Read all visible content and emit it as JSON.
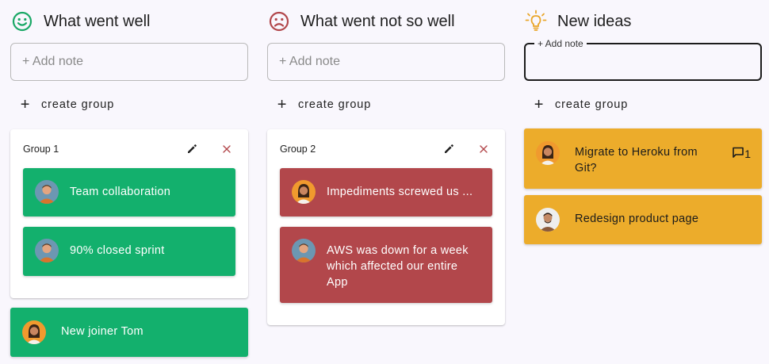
{
  "columns": [
    {
      "title": "What went well",
      "icon": "smile-icon",
      "input_placeholder": "+ Add note",
      "create_group_label": "create group",
      "group": {
        "title": "Group 1",
        "cards": [
          {
            "text": "Team collaboration",
            "avatar": "avatar-man-blue"
          },
          {
            "text": "90% closed sprint",
            "avatar": "avatar-man-blue"
          }
        ]
      },
      "loose_cards": [
        {
          "text": "New joiner Tom",
          "avatar": "avatar-woman-orange"
        }
      ]
    },
    {
      "title": "What went not so well",
      "icon": "frown-icon",
      "input_placeholder": "+ Add note",
      "create_group_label": "create group",
      "group": {
        "title": "Group 2",
        "cards": [
          {
            "text": "Impediments screwed us ...",
            "avatar": "avatar-woman-orange"
          },
          {
            "text": "AWS was down for a week which affected our entire App",
            "avatar": "avatar-man-blue"
          }
        ]
      }
    },
    {
      "title": "New ideas",
      "icon": "lightbulb-icon",
      "input_label": "+ Add note",
      "input_value": "",
      "create_group_label": "create group",
      "cards": [
        {
          "text": "Migrate to Heroku from Git?",
          "avatar": "avatar-woman-orange",
          "comments": "1"
        },
        {
          "text": "Redesign product page",
          "avatar": "avatar-man-white"
        }
      ]
    }
  ],
  "colors": {
    "well": "#13b06d",
    "not_well": "#b2474b",
    "ideas": "#ecac2b",
    "smile_icon": "#1aa866",
    "frown_icon": "#b2474b",
    "bulb_icon": "#e9a62a"
  }
}
